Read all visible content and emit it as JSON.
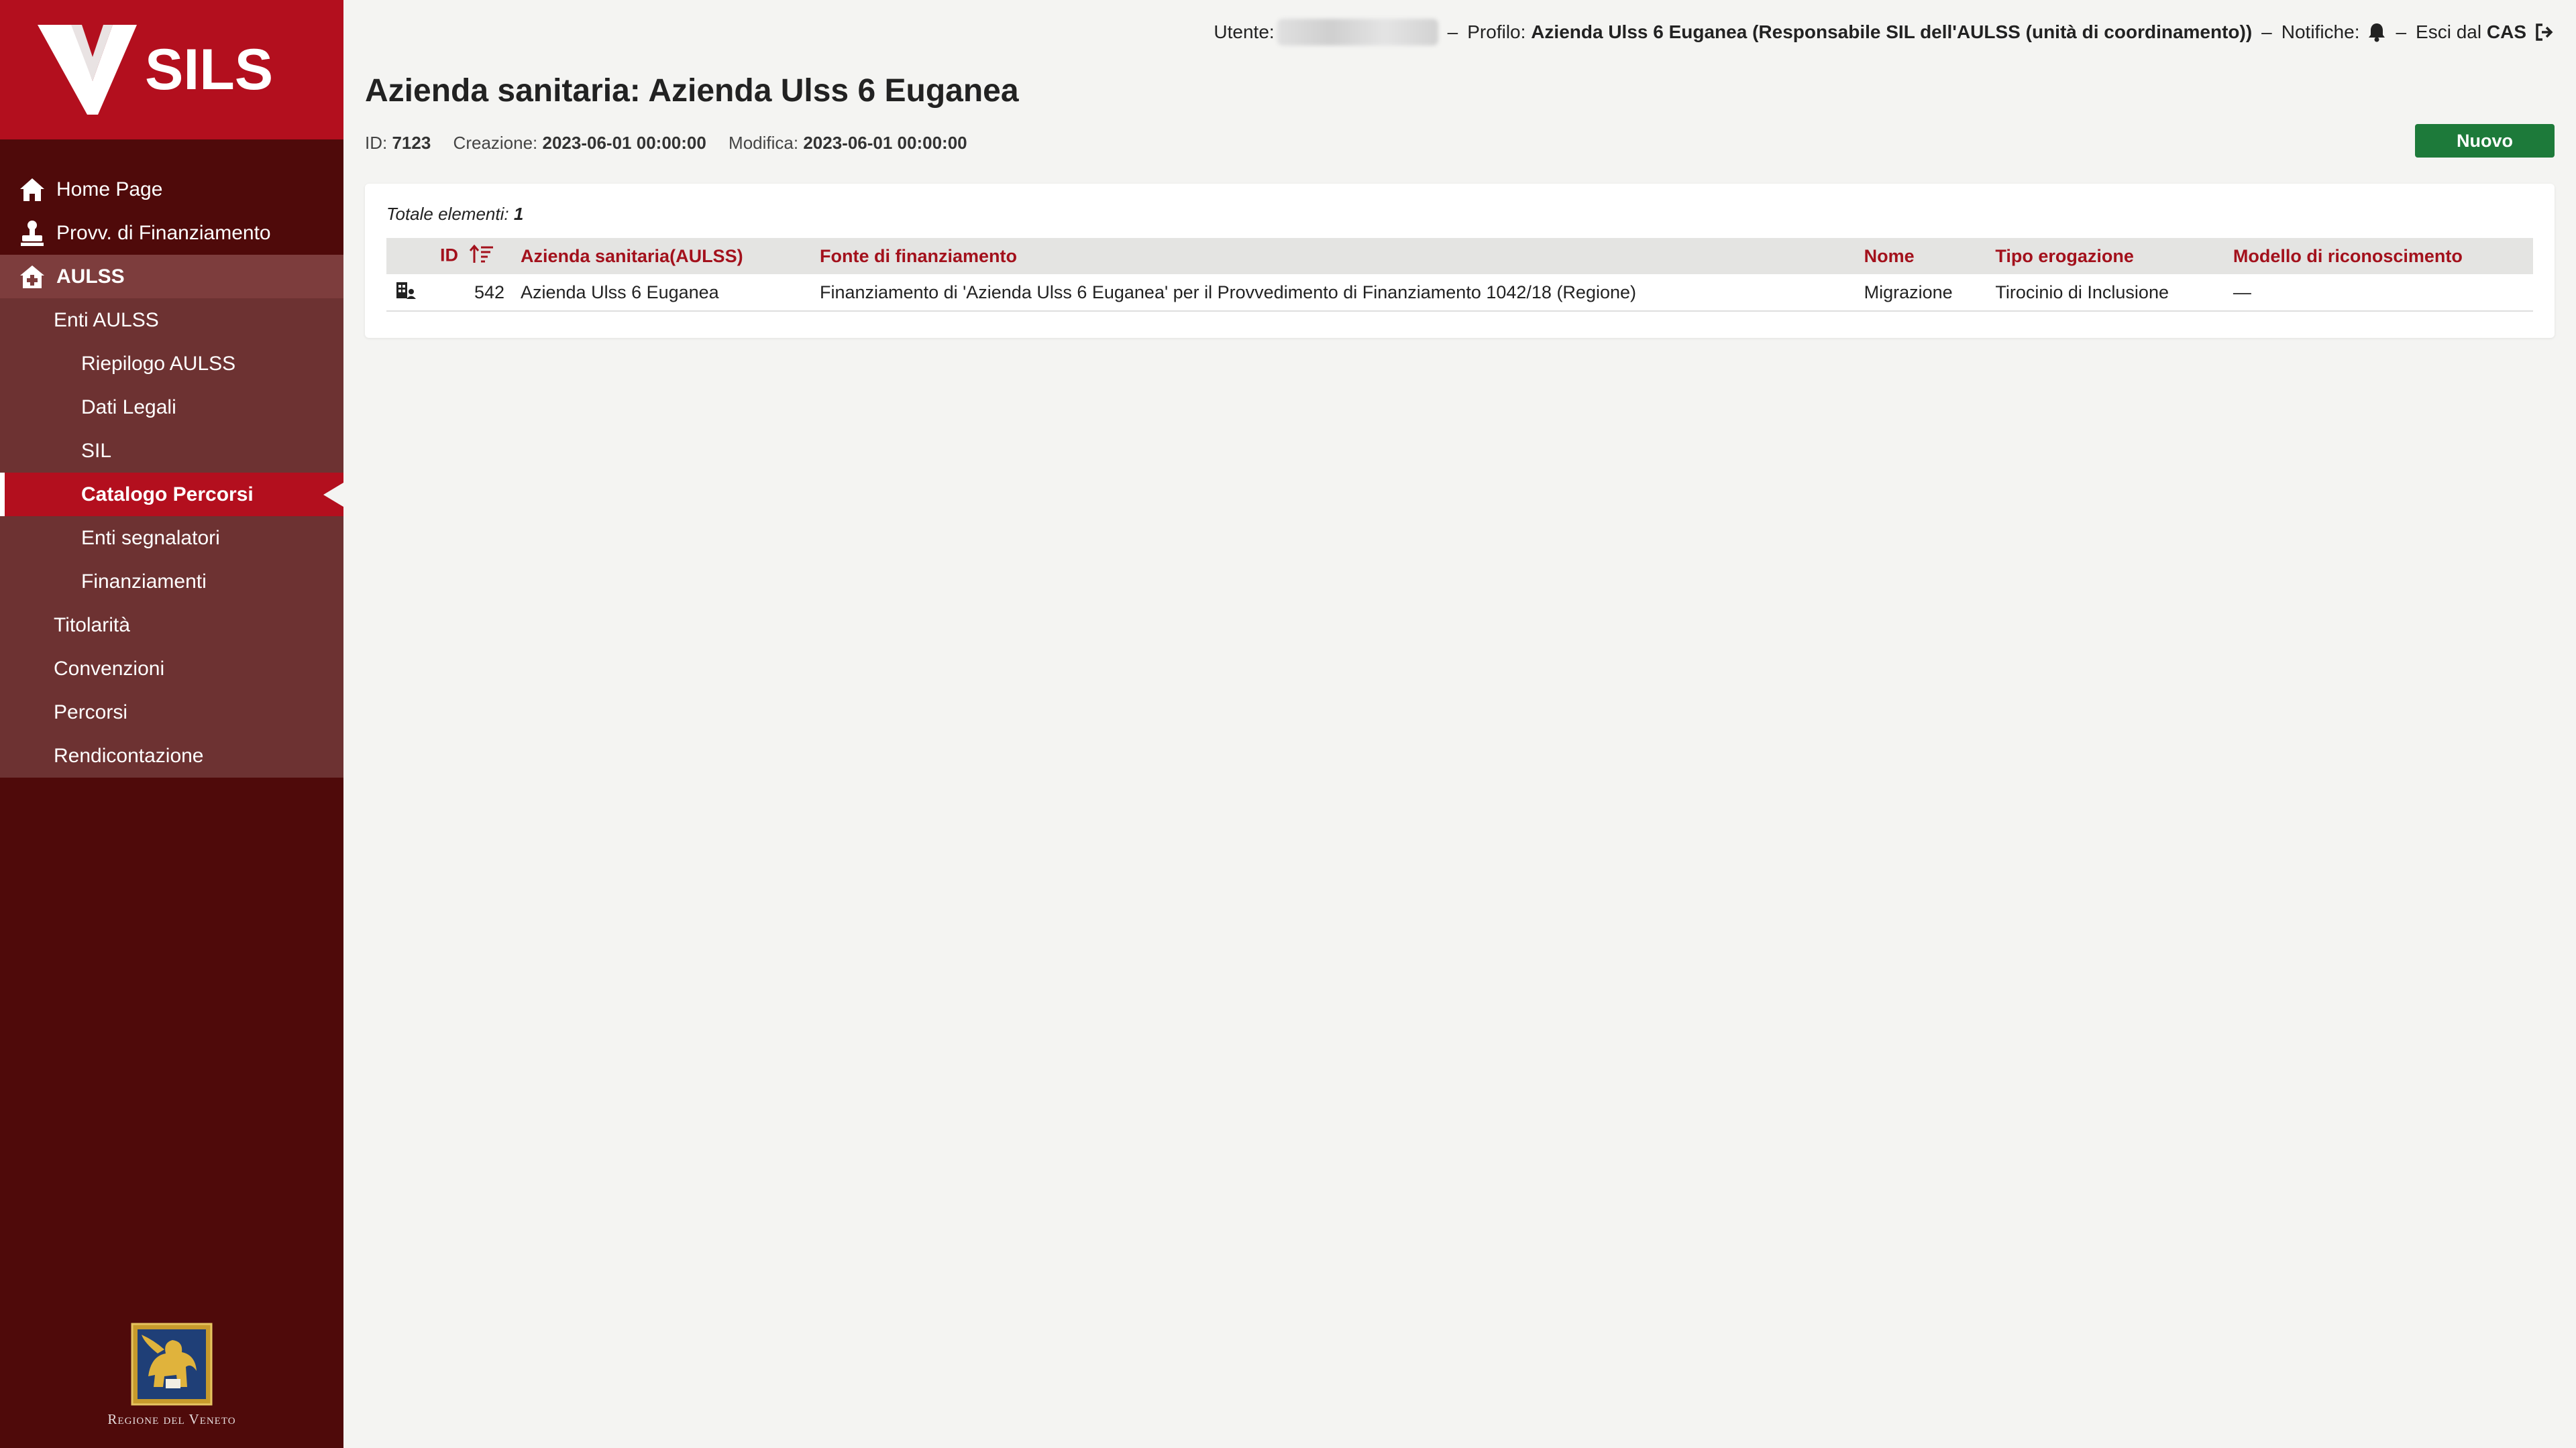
{
  "app": {
    "logo_text": "SILS"
  },
  "topbar": {
    "user_label": "Utente:",
    "profile_label": "Profilo:",
    "profile_value": "Azienda Ulss 6 Euganea (Responsabile SIL dell'AULSS (unità di coordinamento))",
    "notifications_label": "Notifiche:",
    "logout_label": "Esci dal",
    "logout_strong": "CAS",
    "separator": "–"
  },
  "sidebar": {
    "items": [
      {
        "label": "Home Page",
        "icon": "home-icon",
        "level": 1
      },
      {
        "label": "Provv. di Finanziamento",
        "icon": "stamp-icon",
        "level": 1
      },
      {
        "label": "AULSS",
        "icon": "hospital-icon",
        "level": 1,
        "open": true
      },
      {
        "label": "Enti AULSS",
        "level": 2
      },
      {
        "label": "Riepilogo AULSS",
        "level": 3
      },
      {
        "label": "Dati Legali",
        "level": 3
      },
      {
        "label": "SIL",
        "level": 3
      },
      {
        "label": "Catalogo Percorsi",
        "level": 3,
        "active": true
      },
      {
        "label": "Enti segnalatori",
        "level": 3
      },
      {
        "label": "Finanziamenti",
        "level": 3
      },
      {
        "label": "Titolarità",
        "level": 2
      },
      {
        "label": "Convenzioni",
        "level": 2
      },
      {
        "label": "Percorsi",
        "level": 2
      },
      {
        "label": "Rendicontazione",
        "level": 2
      }
    ],
    "footer_label": "Regione del Veneto"
  },
  "page": {
    "title_prefix": "Azienda sanitaria:",
    "title_value": "Azienda Ulss 6 Euganea",
    "meta": {
      "id_label": "ID:",
      "id_value": "7123",
      "created_label": "Creazione:",
      "created_value": "2023-06-01 00:00:00",
      "modified_label": "Modifica:",
      "modified_value": "2023-06-01 00:00:00"
    },
    "new_button": "Nuovo"
  },
  "table": {
    "total_label": "Totale elementi:",
    "total_value": "1",
    "columns": [
      "ID",
      "Azienda sanitaria(AULSS)",
      "Fonte di finanziamento",
      "Nome",
      "Tipo erogazione",
      "Modello di riconoscimento"
    ],
    "rows": [
      {
        "id": "542",
        "azienda": "Azienda Ulss 6 Euganea",
        "fonte": "Finanziamento di 'Azienda Ulss 6 Euganea' per il Provvedimento di Finanziamento 1042/18 (Regione)",
        "nome": "Migrazione",
        "tipo": "Tirocinio di Inclusione",
        "modello": "—"
      }
    ]
  },
  "colors": {
    "brand_red": "#b30f1e",
    "sidebar_dark": "#4f0a0a",
    "sidebar_sub": "#6d3232",
    "new_button_green": "#1d7a3a",
    "header_text_red": "#a3111c"
  }
}
